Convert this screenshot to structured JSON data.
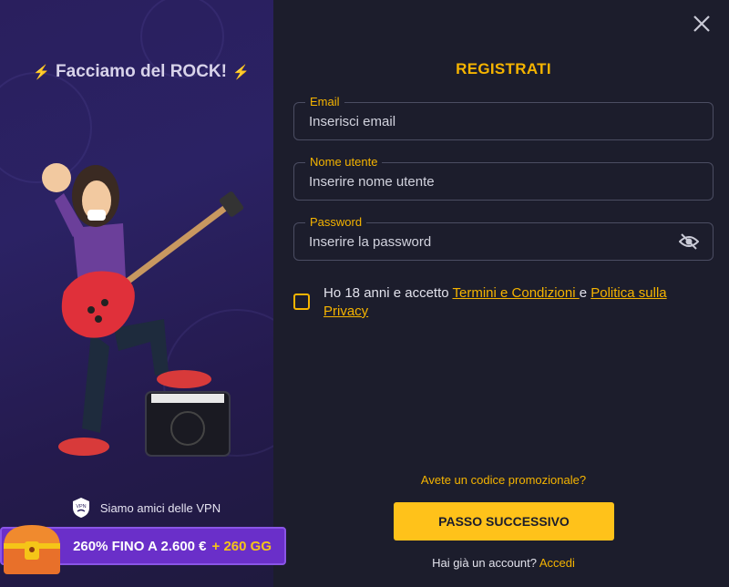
{
  "promo_side": {
    "tagline": "Facciamo del ROCK!",
    "bolt_icon": "⚡",
    "vpn_text": "Siamo amici delle VPN",
    "vpn_badge": "VPN",
    "bonus_text": "260% FINO A 2.600 €",
    "bonus_extra": "+ 260 GG"
  },
  "form": {
    "title": "REGISTRATI",
    "email": {
      "label": "Email",
      "placeholder": "Inserisci email",
      "value": ""
    },
    "username": {
      "label": "Nome utente",
      "placeholder": "Inserire nome utente",
      "value": ""
    },
    "password": {
      "label": "Password",
      "placeholder": "Inserire la password",
      "value": ""
    },
    "agree_prefix": "Ho 18 anni e accetto ",
    "terms_link": "Termini e Condizioni ",
    "agree_and": " e ",
    "privacy_link": "Politica sulla Privacy",
    "checkbox_checked": false,
    "promo_code_link": "Avete un codice promozionale?",
    "next_button": "PASSO SUCCESSIVO",
    "have_account": "Hai già un account? ",
    "login_link": "Accedi"
  },
  "colors": {
    "accent": "#f5b400",
    "background": "#1c1d2c",
    "left_panel": "#2a1f5e",
    "banner": "#6a2fc9"
  }
}
